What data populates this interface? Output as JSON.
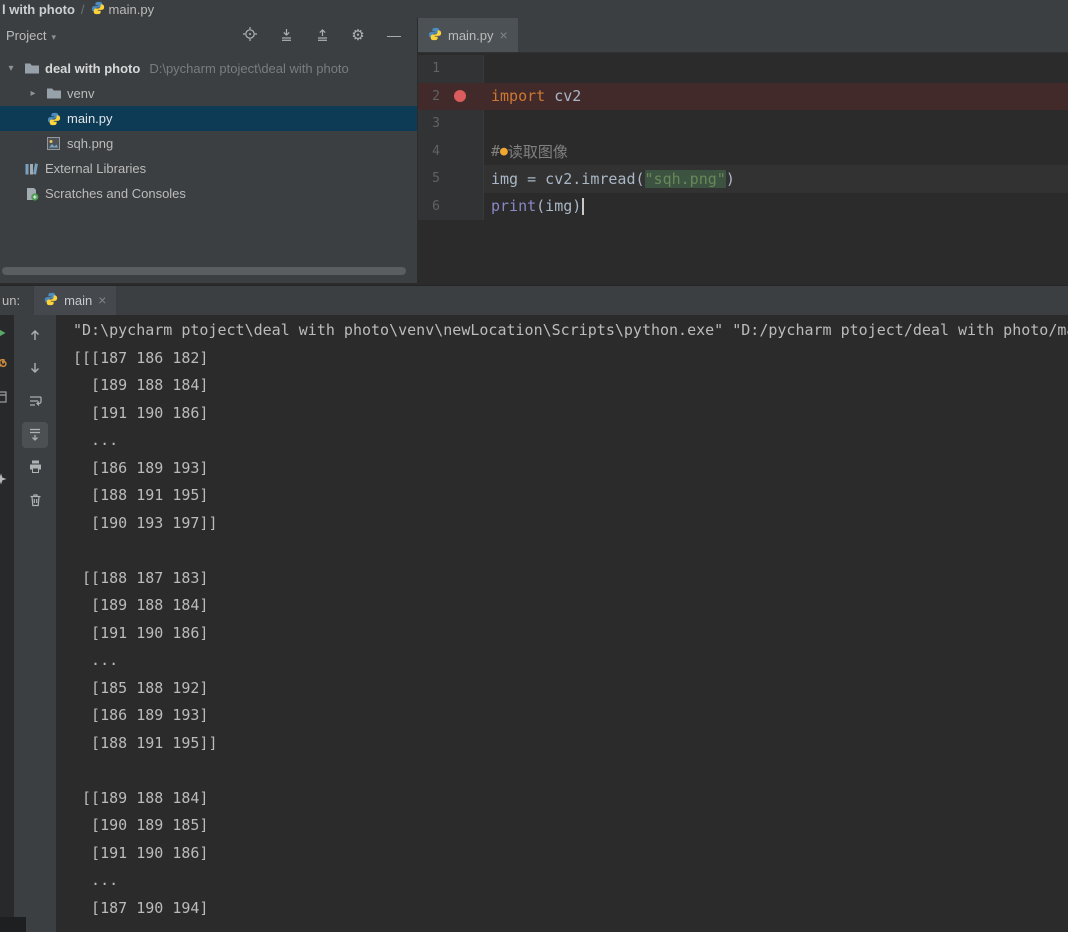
{
  "colors": {
    "background": "#2b2b2b",
    "panel": "#3c3f41",
    "selection": "#0d3a55",
    "breakpoint_line": "#432a2a",
    "breakpoint_dot": "#db5c5c",
    "keyword": "#cc7832",
    "string": "#6a8759",
    "comment": "#808080",
    "builtin": "#8888c6",
    "plain_code": "#a9b7c6",
    "console_text": "#bbbbbb",
    "line_number": "#606366",
    "run_green": "#59a869"
  },
  "titlebar": {
    "path_segment": "l with photo",
    "separator": "/",
    "file": "main.py"
  },
  "project": {
    "title": "Project",
    "toolbar_icons": [
      {
        "name": "locate"
      },
      {
        "name": "collapse-all"
      },
      {
        "name": "expand-all"
      },
      {
        "name": "settings"
      },
      {
        "name": "hide"
      }
    ],
    "tree": [
      {
        "label": "deal with photo",
        "path": " D:\\pycharm ptoject\\deal with photo",
        "icon": "folder",
        "arrow": "expanded",
        "bold": true,
        "indent": 0
      },
      {
        "label": "venv",
        "icon": "folder",
        "arrow": "collapsed",
        "indent": 1
      },
      {
        "label": "main.py",
        "icon": "python",
        "selected": true,
        "indent": 1
      },
      {
        "label": "sqh.png",
        "icon": "image",
        "indent": 1
      },
      {
        "label": "External Libraries",
        "icon": "libraries",
        "indent": 0
      },
      {
        "label": "Scratches and Consoles",
        "icon": "scratches",
        "indent": 0
      }
    ]
  },
  "editor": {
    "tab": {
      "label": "main.py"
    },
    "lines": [
      {
        "num": "1",
        "tokens": []
      },
      {
        "num": "2",
        "breakpoint": true,
        "highlight": "breakpoint",
        "tokens": [
          {
            "c": "keyword",
            "t": "import"
          },
          {
            "c": "plain",
            "t": " cv2"
          }
        ]
      },
      {
        "num": "3",
        "tokens": []
      },
      {
        "num": "4",
        "tokens": [
          {
            "c": "comment",
            "t": "#"
          },
          {
            "c": "bulb",
            "t": "●"
          },
          {
            "c": "comment",
            "t": "读取图像"
          }
        ]
      },
      {
        "num": "5",
        "highlight": "line",
        "tokens": [
          {
            "c": "plain",
            "t": "img = cv2.imread("
          },
          {
            "c": "string",
            "t": "\"sqh.png\""
          },
          {
            "c": "plain",
            "t": ")"
          }
        ]
      },
      {
        "num": "6",
        "caret": true,
        "tokens": [
          {
            "c": "builtin",
            "t": "print"
          },
          {
            "c": "plain",
            "t": "(img)"
          }
        ]
      }
    ]
  },
  "run": {
    "tab_prefix": "un:",
    "tab_label": "main",
    "toolbar_icons": [
      {
        "name": "arrow-up"
      },
      {
        "name": "arrow-down"
      },
      {
        "name": "soft-wrap"
      },
      {
        "name": "scroll-to-end",
        "selected": true
      },
      {
        "name": "print"
      },
      {
        "name": "clear"
      }
    ],
    "stripe_icons": [
      {
        "name": "play"
      },
      {
        "name": "wrench"
      },
      {
        "name": "window"
      },
      {
        "name": "star"
      }
    ],
    "console_lines": [
      "\"D:\\pycharm ptoject\\deal with photo\\venv\\newLocation\\Scripts\\python.exe\" \"D:/pycharm ptoject/deal with photo/main.py\"",
      "[[[187 186 182]",
      "  [189 188 184]",
      "  [191 190 186]",
      "  ...",
      "  [186 189 193]",
      "  [188 191 195]",
      "  [190 193 197]]",
      "",
      " [[188 187 183]",
      "  [189 188 184]",
      "  [191 190 186]",
      "  ...",
      "  [185 188 192]",
      "  [186 189 193]",
      "  [188 191 195]]",
      "",
      " [[189 188 184]",
      "  [190 189 185]",
      "  [191 190 186]",
      "  ...",
      "  [187 190 194]"
    ]
  }
}
